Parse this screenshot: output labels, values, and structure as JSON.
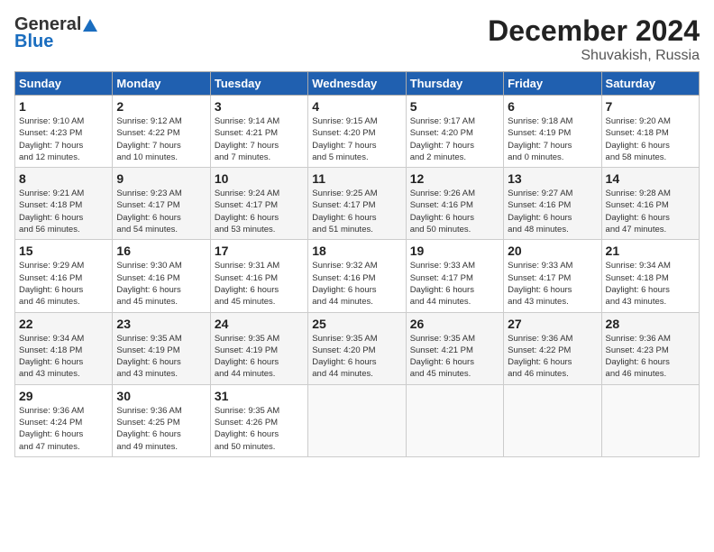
{
  "header": {
    "logo_general": "General",
    "logo_blue": "Blue",
    "title": "December 2024",
    "subtitle": "Shuvakish, Russia"
  },
  "columns": [
    "Sunday",
    "Monday",
    "Tuesday",
    "Wednesday",
    "Thursday",
    "Friday",
    "Saturday"
  ],
  "weeks": [
    [
      {
        "day": "1",
        "lines": [
          "Sunrise: 9:10 AM",
          "Sunset: 4:23 PM",
          "Daylight: 7 hours",
          "and 12 minutes."
        ]
      },
      {
        "day": "2",
        "lines": [
          "Sunrise: 9:12 AM",
          "Sunset: 4:22 PM",
          "Daylight: 7 hours",
          "and 10 minutes."
        ]
      },
      {
        "day": "3",
        "lines": [
          "Sunrise: 9:14 AM",
          "Sunset: 4:21 PM",
          "Daylight: 7 hours",
          "and 7 minutes."
        ]
      },
      {
        "day": "4",
        "lines": [
          "Sunrise: 9:15 AM",
          "Sunset: 4:20 PM",
          "Daylight: 7 hours",
          "and 5 minutes."
        ]
      },
      {
        "day": "5",
        "lines": [
          "Sunrise: 9:17 AM",
          "Sunset: 4:20 PM",
          "Daylight: 7 hours",
          "and 2 minutes."
        ]
      },
      {
        "day": "6",
        "lines": [
          "Sunrise: 9:18 AM",
          "Sunset: 4:19 PM",
          "Daylight: 7 hours",
          "and 0 minutes."
        ]
      },
      {
        "day": "7",
        "lines": [
          "Sunrise: 9:20 AM",
          "Sunset: 4:18 PM",
          "Daylight: 6 hours",
          "and 58 minutes."
        ]
      }
    ],
    [
      {
        "day": "8",
        "lines": [
          "Sunrise: 9:21 AM",
          "Sunset: 4:18 PM",
          "Daylight: 6 hours",
          "and 56 minutes."
        ]
      },
      {
        "day": "9",
        "lines": [
          "Sunrise: 9:23 AM",
          "Sunset: 4:17 PM",
          "Daylight: 6 hours",
          "and 54 minutes."
        ]
      },
      {
        "day": "10",
        "lines": [
          "Sunrise: 9:24 AM",
          "Sunset: 4:17 PM",
          "Daylight: 6 hours",
          "and 53 minutes."
        ]
      },
      {
        "day": "11",
        "lines": [
          "Sunrise: 9:25 AM",
          "Sunset: 4:17 PM",
          "Daylight: 6 hours",
          "and 51 minutes."
        ]
      },
      {
        "day": "12",
        "lines": [
          "Sunrise: 9:26 AM",
          "Sunset: 4:16 PM",
          "Daylight: 6 hours",
          "and 50 minutes."
        ]
      },
      {
        "day": "13",
        "lines": [
          "Sunrise: 9:27 AM",
          "Sunset: 4:16 PM",
          "Daylight: 6 hours",
          "and 48 minutes."
        ]
      },
      {
        "day": "14",
        "lines": [
          "Sunrise: 9:28 AM",
          "Sunset: 4:16 PM",
          "Daylight: 6 hours",
          "and 47 minutes."
        ]
      }
    ],
    [
      {
        "day": "15",
        "lines": [
          "Sunrise: 9:29 AM",
          "Sunset: 4:16 PM",
          "Daylight: 6 hours",
          "and 46 minutes."
        ]
      },
      {
        "day": "16",
        "lines": [
          "Sunrise: 9:30 AM",
          "Sunset: 4:16 PM",
          "Daylight: 6 hours",
          "and 45 minutes."
        ]
      },
      {
        "day": "17",
        "lines": [
          "Sunrise: 9:31 AM",
          "Sunset: 4:16 PM",
          "Daylight: 6 hours",
          "and 45 minutes."
        ]
      },
      {
        "day": "18",
        "lines": [
          "Sunrise: 9:32 AM",
          "Sunset: 4:16 PM",
          "Daylight: 6 hours",
          "and 44 minutes."
        ]
      },
      {
        "day": "19",
        "lines": [
          "Sunrise: 9:33 AM",
          "Sunset: 4:17 PM",
          "Daylight: 6 hours",
          "and 44 minutes."
        ]
      },
      {
        "day": "20",
        "lines": [
          "Sunrise: 9:33 AM",
          "Sunset: 4:17 PM",
          "Daylight: 6 hours",
          "and 43 minutes."
        ]
      },
      {
        "day": "21",
        "lines": [
          "Sunrise: 9:34 AM",
          "Sunset: 4:18 PM",
          "Daylight: 6 hours",
          "and 43 minutes."
        ]
      }
    ],
    [
      {
        "day": "22",
        "lines": [
          "Sunrise: 9:34 AM",
          "Sunset: 4:18 PM",
          "Daylight: 6 hours",
          "and 43 minutes."
        ]
      },
      {
        "day": "23",
        "lines": [
          "Sunrise: 9:35 AM",
          "Sunset: 4:19 PM",
          "Daylight: 6 hours",
          "and 43 minutes."
        ]
      },
      {
        "day": "24",
        "lines": [
          "Sunrise: 9:35 AM",
          "Sunset: 4:19 PM",
          "Daylight: 6 hours",
          "and 44 minutes."
        ]
      },
      {
        "day": "25",
        "lines": [
          "Sunrise: 9:35 AM",
          "Sunset: 4:20 PM",
          "Daylight: 6 hours",
          "and 44 minutes."
        ]
      },
      {
        "day": "26",
        "lines": [
          "Sunrise: 9:35 AM",
          "Sunset: 4:21 PM",
          "Daylight: 6 hours",
          "and 45 minutes."
        ]
      },
      {
        "day": "27",
        "lines": [
          "Sunrise: 9:36 AM",
          "Sunset: 4:22 PM",
          "Daylight: 6 hours",
          "and 46 minutes."
        ]
      },
      {
        "day": "28",
        "lines": [
          "Sunrise: 9:36 AM",
          "Sunset: 4:23 PM",
          "Daylight: 6 hours",
          "and 46 minutes."
        ]
      }
    ],
    [
      {
        "day": "29",
        "lines": [
          "Sunrise: 9:36 AM",
          "Sunset: 4:24 PM",
          "Daylight: 6 hours",
          "and 47 minutes."
        ]
      },
      {
        "day": "30",
        "lines": [
          "Sunrise: 9:36 AM",
          "Sunset: 4:25 PM",
          "Daylight: 6 hours",
          "and 49 minutes."
        ]
      },
      {
        "day": "31",
        "lines": [
          "Sunrise: 9:35 AM",
          "Sunset: 4:26 PM",
          "Daylight: 6 hours",
          "and 50 minutes."
        ]
      },
      null,
      null,
      null,
      null
    ]
  ]
}
